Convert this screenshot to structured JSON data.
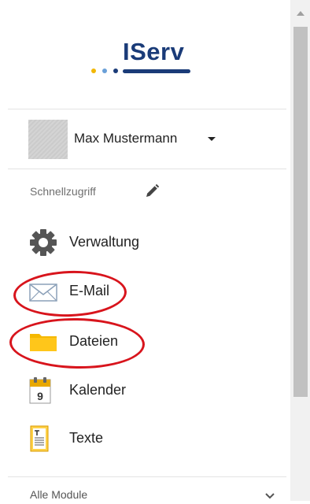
{
  "logo": {
    "text": "IServ",
    "dot_colors": [
      "#f2b705",
      "#6aa0d8",
      "#1a3b78"
    ]
  },
  "user": {
    "name": "Max Mustermann"
  },
  "quick_access": {
    "heading": "Schnellzugriff",
    "items": [
      {
        "label": "Verwaltung",
        "icon": "gear-icon"
      },
      {
        "label": "E-Mail",
        "icon": "envelope-icon"
      },
      {
        "label": "Dateien",
        "icon": "folder-icon"
      },
      {
        "label": "Kalender",
        "icon": "calendar-icon",
        "icon_text": "9"
      },
      {
        "label": "Texte",
        "icon": "text-document-icon"
      }
    ]
  },
  "all_modules": {
    "label": "Alle Module"
  },
  "colors": {
    "brand": "#1a3b78",
    "annotation": "#d8141c",
    "folder": "#f5b800"
  }
}
